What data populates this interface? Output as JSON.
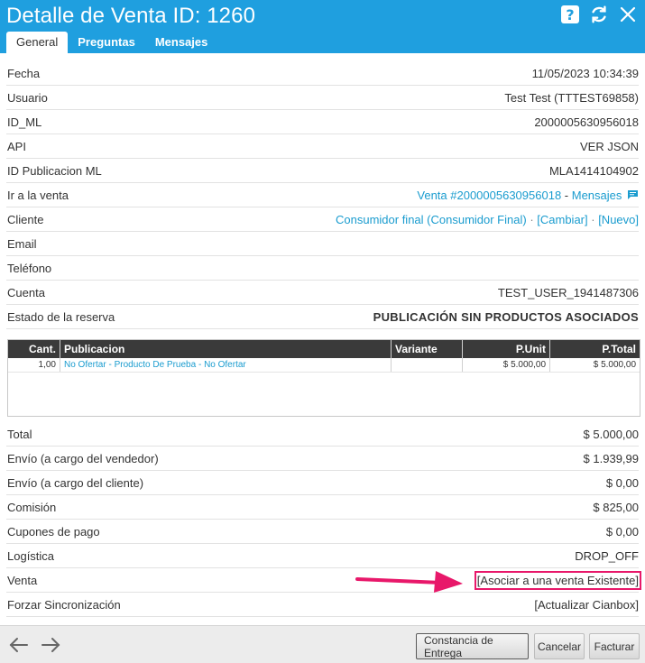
{
  "header": {
    "title": "Detalle de Venta ID: 1260",
    "tabs": [
      {
        "label": "General"
      },
      {
        "label": "Preguntas"
      },
      {
        "label": "Mensajes"
      }
    ]
  },
  "fields": {
    "fecha": {
      "label": "Fecha",
      "value": "11/05/2023 10:34:39"
    },
    "usuario": {
      "label": "Usuario",
      "value": "Test Test (TTTEST69858)"
    },
    "id_ml": {
      "label": "ID_ML",
      "value": "2000005630956018"
    },
    "api": {
      "label": "API",
      "value": "VER JSON"
    },
    "id_publicacion": {
      "label": "ID Publicacion ML",
      "value": "MLA1414104902"
    },
    "ir_venta": {
      "label": "Ir a la venta",
      "venta_link": "Venta #2000005630956018",
      "sep": " - ",
      "mensajes_link": "Mensajes"
    },
    "cliente": {
      "label": "Cliente",
      "value": "Consumidor final (Consumidor Final)",
      "cambiar": "[Cambiar]",
      "nuevo": "[Nuevo]",
      "sep": " · "
    },
    "email": {
      "label": "Email",
      "value": ""
    },
    "telefono": {
      "label": "Teléfono",
      "value": ""
    },
    "cuenta": {
      "label": "Cuenta",
      "value": "TEST_USER_1941487306"
    },
    "estado_reserva": {
      "label": "Estado de la reserva",
      "value": "PUBLICACIÓN SIN PRODUCTOS ASOCIADOS"
    }
  },
  "items_table": {
    "columns": [
      "Cant.",
      "Publicacion",
      "Variante",
      "P.Unit",
      "P.Total"
    ],
    "rows": [
      {
        "cant": "1,00",
        "publicacion": "No Ofertar - Producto De Prueba - No Ofertar",
        "variante": "",
        "punit": "$ 5.000,00",
        "ptotal": "$ 5.000,00"
      }
    ]
  },
  "totals": {
    "total": {
      "label": "Total",
      "value": "$ 5.000,00"
    },
    "envio_vendedor": {
      "label": "Envío (a cargo del vendedor)",
      "value": "$ 1.939,99"
    },
    "envio_cliente": {
      "label": "Envío (a cargo del cliente)",
      "value": "$ 0,00"
    },
    "comision": {
      "label": "Comisión",
      "value": "$ 825,00"
    },
    "cupones": {
      "label": "Cupones de pago",
      "value": "$ 0,00"
    },
    "logistica": {
      "label": "Logística",
      "value": "DROP_OFF"
    },
    "venta": {
      "label": "Venta",
      "value": "[Asociar a una venta Existente]"
    },
    "forzar": {
      "label": "Forzar Sincronización",
      "value": "[Actualizar Cianbox]"
    }
  },
  "footer": {
    "constancia": "Constancia de Entrega",
    "cancelar": "Cancelar",
    "facturar": "Facturar"
  },
  "colors": {
    "header": "#1f9fdf",
    "link": "#1a9ccf",
    "danger": "#d9182d",
    "annotation_arrow": "#e8186a"
  },
  "icons": [
    "help-icon",
    "refresh-icon",
    "close-icon",
    "chat-icon",
    "arrow-left-icon",
    "arrow-right-icon"
  ]
}
